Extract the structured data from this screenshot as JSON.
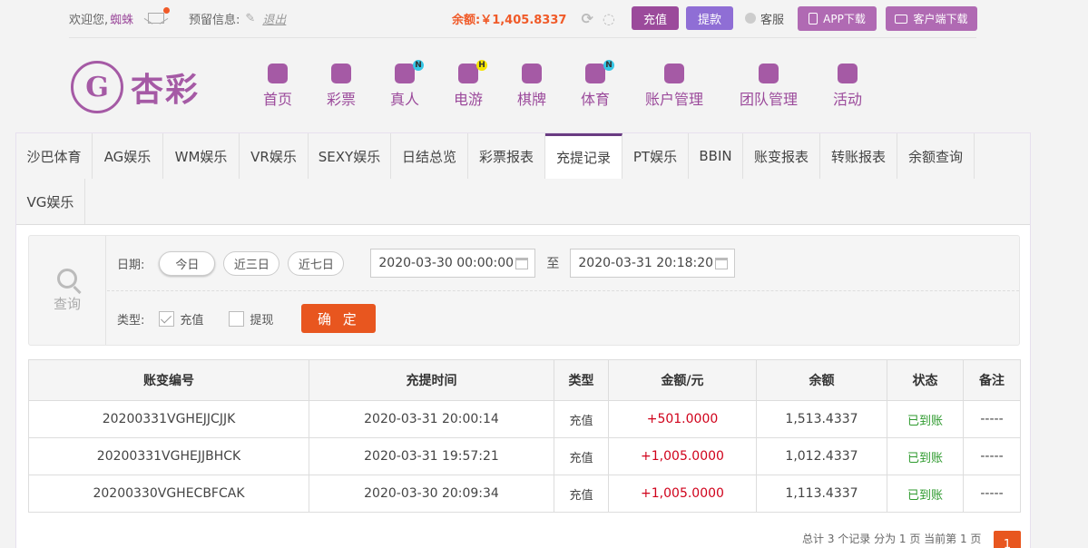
{
  "topbar": {
    "welcome_label": "欢迎您,",
    "username": "蜘蛛",
    "reserve_label": "预留信息:",
    "logout_label": "退出",
    "balance_label": "余额:",
    "balance_value": "￥1,405.8337",
    "charge_label": "充值",
    "withdraw_label": "提款",
    "service_label": "客服",
    "app_download_label": "APP下载",
    "client_download_label": "客户端下载"
  },
  "logo": {
    "mark": "G",
    "name": "杏彩"
  },
  "nav": [
    {
      "label": "首页",
      "icon": "home-icon",
      "badge": ""
    },
    {
      "label": "彩票",
      "icon": "lottery-icon",
      "badge": ""
    },
    {
      "label": "真人",
      "icon": "live-dealer-icon",
      "badge": "N"
    },
    {
      "label": "电游",
      "icon": "gamepad-icon",
      "badge": "H"
    },
    {
      "label": "棋牌",
      "icon": "cards-icon",
      "badge": ""
    },
    {
      "label": "体育",
      "icon": "trophy-icon",
      "badge": "N"
    },
    {
      "label": "账户管理",
      "icon": "account-icon",
      "badge": ""
    },
    {
      "label": "团队管理",
      "icon": "team-icon",
      "badge": ""
    },
    {
      "label": "活动",
      "icon": "gift-icon",
      "badge": ""
    }
  ],
  "tabs": [
    "沙巴体育",
    "AG娱乐",
    "WM娱乐",
    "VR娱乐",
    "SEXY娱乐",
    "日结总览",
    "彩票报表",
    "充提记录",
    "PT娱乐",
    "BBIN",
    "账变报表",
    "转账报表",
    "余额查询",
    "VG娱乐"
  ],
  "active_tab": "充提记录",
  "search": {
    "panel_label": "查询",
    "date_label": "日期:",
    "quick_ranges": [
      "今日",
      "近三日",
      "近七日"
    ],
    "start_date": "2020-03-30 00:00:00",
    "to_label": "至",
    "end_date": "2020-03-31 20:18:20",
    "type_label": "类型:",
    "types": [
      {
        "label": "充值",
        "checked": true
      },
      {
        "label": "提现",
        "checked": false
      }
    ],
    "confirm_label": "确 定"
  },
  "table": {
    "columns": [
      "账变编号",
      "充提时间",
      "类型",
      "金额/元",
      "余额",
      "状态",
      "备注"
    ],
    "rows": [
      [
        "20200331VGHEJJCJJK",
        "2020-03-31 20:00:14",
        "充值",
        "+501.0000",
        "1,513.4337",
        "已到账",
        "-----"
      ],
      [
        "20200331VGHEJJBHCK",
        "2020-03-31 19:57:21",
        "充值",
        "+1,005.0000",
        "1,012.4337",
        "已到账",
        "-----"
      ],
      [
        "20200330VGHECBFCAK",
        "2020-03-30 20:09:34",
        "充值",
        "+1,005.0000",
        "1,113.4337",
        "已到账",
        "-----"
      ]
    ]
  },
  "pager": {
    "summary": "总计 3 个记录 分为 1 页 当前第 1 页",
    "current_page": "1"
  },
  "colors": {
    "brand": "#9b4a9b",
    "accent": "#e8561f",
    "status_ok": "#2e9a2e",
    "amount": "#d0021b"
  }
}
